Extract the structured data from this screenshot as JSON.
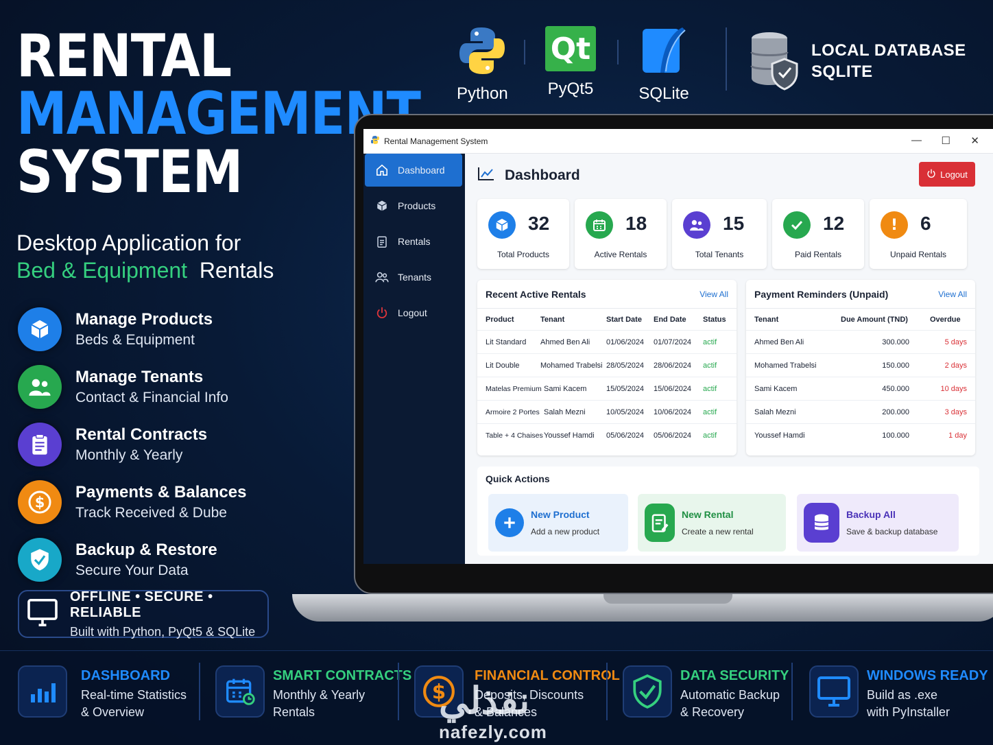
{
  "hero": {
    "line1": "RENTAL",
    "line2": "MANAGEMENT",
    "line3": "SYSTEM",
    "subtitle_line1": "Desktop Application for",
    "subtitle_green": "Bed & Equipment",
    "subtitle_rest": "Rentals"
  },
  "features": [
    {
      "title": "Manage Products",
      "sub": "Beds & Equipment",
      "icon": "cube-icon",
      "color": "#1e7fe8"
    },
    {
      "title": "Manage Tenants",
      "sub": "Contact & Financial Info",
      "icon": "users-icon",
      "color": "#27a84f"
    },
    {
      "title": "Rental Contracts",
      "sub": "Monthly & Yearly",
      "icon": "clipboard-icon",
      "color": "#5a3fd1"
    },
    {
      "title": "Payments & Balances",
      "sub": "Track Received & Dube",
      "icon": "dollar-icon",
      "color": "#f08a12"
    },
    {
      "title": "Backup & Restore",
      "sub": "Secure Your Data",
      "icon": "shield-check-icon",
      "color": "#18a8c8"
    }
  ],
  "offline": {
    "title": "OFFLINE • SECURE • RELIABLE",
    "sub": "Built with Python, PyQt5 & SQLite"
  },
  "tech": [
    {
      "label": "Python",
      "icon": "python-icon"
    },
    {
      "label": "PyQt5",
      "icon": "qt-icon",
      "logo_text": "Qt"
    },
    {
      "label": "SQLite",
      "icon": "sqlite-feather-icon"
    }
  ],
  "localdb": {
    "line1": "LOCAL DATABASE",
    "line2": "SQLITE",
    "icon": "database-shield-icon"
  },
  "app": {
    "window_title": "Rental Management System",
    "nav": [
      {
        "label": "Dashboard",
        "icon": "home-icon",
        "active": true
      },
      {
        "label": "Products",
        "icon": "box-icon"
      },
      {
        "label": "Rentals",
        "icon": "clipboard-icon"
      },
      {
        "label": "Tenants",
        "icon": "users-icon"
      },
      {
        "label": "Logout",
        "icon": "power-icon"
      }
    ],
    "page_title": "Dashboard",
    "logout_label": "Logout",
    "stats": [
      {
        "value": "32",
        "label": "Total Products",
        "color": "#1e7fe8",
        "icon": "cube-icon"
      },
      {
        "value": "18",
        "label": "Active Rentals",
        "color": "#27a84f",
        "icon": "calendar-icon"
      },
      {
        "value": "15",
        "label": "Total Tenants",
        "color": "#5a3fd1",
        "icon": "users-icon"
      },
      {
        "value": "12",
        "label": "Paid Rentals",
        "color": "#27a84f",
        "icon": "check-icon"
      },
      {
        "value": "6",
        "label": "Unpaid Rentals",
        "color": "#f08a12",
        "icon": "exclamation-icon"
      }
    ],
    "recent": {
      "title": "Recent Active Rentals",
      "view_all": "View All",
      "headers": [
        "Product",
        "Tenant",
        "Start Date",
        "End Date",
        "Status"
      ],
      "rows": [
        [
          "Lit Standard",
          "Ahmed Ben Ali",
          "01/06/2024",
          "01/07/2024",
          "actif"
        ],
        [
          "Lit Double",
          "Mohamed Trabelsi",
          "28/05/2024",
          "28/06/2024",
          "actif"
        ],
        [
          "Matelas Premium",
          "Sami Kacem",
          "15/05/2024",
          "15/06/2024",
          "actif"
        ],
        [
          "Armoire 2 Portes",
          "Salah Mezni",
          "10/05/2024",
          "10/06/2024",
          "actif"
        ],
        [
          "Table + 4 Chaises",
          "Youssef Hamdi",
          "05/06/2024",
          "05/06/2024",
          "actif"
        ]
      ]
    },
    "reminders": {
      "title": "Payment Reminders (Unpaid)",
      "view_all": "View All",
      "headers": [
        "Tenant",
        "Due Amount (TND)",
        "Overdue"
      ],
      "rows": [
        [
          "Ahmed Ben Ali",
          "300.000",
          "5 days"
        ],
        [
          "Mohamed Trabelsi",
          "150.000",
          "2 days"
        ],
        [
          "Sami Kacem",
          "450.000",
          "10 days"
        ],
        [
          "Salah Mezni",
          "200.000",
          "3 days"
        ],
        [
          "Youssef Hamdi",
          "100.000",
          "1 day"
        ]
      ]
    },
    "quick": {
      "title": "Quick Actions",
      "cards": [
        {
          "title": "New Product",
          "sub": "Add a new product",
          "color": "#1e7fe8",
          "bg": "#eaf2fc",
          "icon": "plus-icon"
        },
        {
          "title": "New Rental",
          "sub": "Create a new rental",
          "color": "#27a84f",
          "bg": "#e8f6ec",
          "icon": "clipboard-edit-icon"
        },
        {
          "title": "Backup All",
          "sub": "Save & backup database",
          "color": "#5a3fd1",
          "bg": "#efeafb",
          "icon": "database-icon"
        }
      ]
    }
  },
  "bottom": [
    {
      "title": "DASHBOARD",
      "sub1": "Real-time Statistics",
      "sub2": "& Overview",
      "color": "#1f8bff",
      "icon": "bar-chart-icon"
    },
    {
      "title": "SMART CONTRACTS",
      "sub1": "Monthly & Yearly",
      "sub2": "Rentals",
      "color": "#35d07f",
      "icon": "calendar-icon"
    },
    {
      "title": "FINANCIAL CONTROL",
      "sub1": "Deposits, Discounts",
      "sub2": "& Balances",
      "color": "#f08a12",
      "icon": "dollar-icon"
    },
    {
      "title": "DATA SECURITY",
      "sub1": "Automatic Backup",
      "sub2": "& Recovery",
      "color": "#35d07f",
      "icon": "shield-check-icon"
    },
    {
      "title": "WINDOWS READY",
      "sub1": "Build as .exe",
      "sub2": "with PyInstaller",
      "color": "#1f8bff",
      "icon": "monitor-icon"
    }
  ],
  "watermark": {
    "arabic": "نفذلي",
    "latin": "nafezly.com"
  }
}
